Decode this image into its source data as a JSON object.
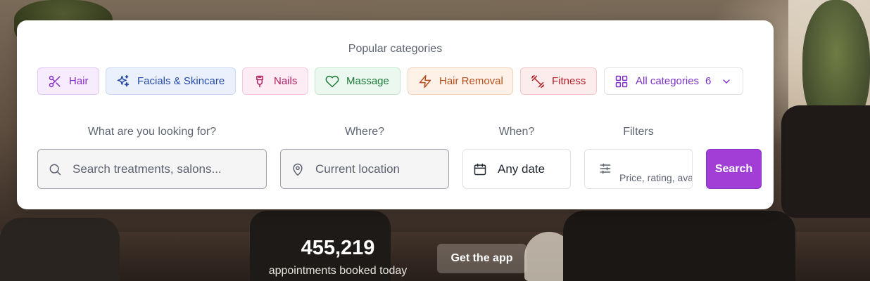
{
  "categories": {
    "title": "Popular categories",
    "items": [
      {
        "label": "Hair",
        "icon": "scissors-icon",
        "color": "#8a2fc4"
      },
      {
        "label": "Facials & Skincare",
        "icon": "sparkles-icon",
        "color": "#2749a8"
      },
      {
        "label": "Nails",
        "icon": "nail-polish-icon",
        "color": "#b0205f"
      },
      {
        "label": "Massage",
        "icon": "heart-icon",
        "color": "#1d7a3a"
      },
      {
        "label": "Hair Removal",
        "icon": "zap-icon",
        "color": "#b4501c"
      },
      {
        "label": "Fitness",
        "icon": "dumbbell-icon",
        "color": "#b3202a"
      }
    ],
    "all": {
      "label": "All categories",
      "count": "6",
      "icon": "grid-icon"
    }
  },
  "search": {
    "what_label": "What are you looking for?",
    "what_placeholder": "Search treatments, salons...",
    "where_label": "Where?",
    "where_placeholder": "Current location",
    "when_label": "When?",
    "when_value": "Any date",
    "filters_label": "Filters",
    "filters_value": "Price, rating, avail",
    "button": "Search",
    "accent": "#a23ed6"
  },
  "stats": {
    "count": "455,219",
    "caption": "appointments booked today"
  },
  "app_button": "Get the app"
}
